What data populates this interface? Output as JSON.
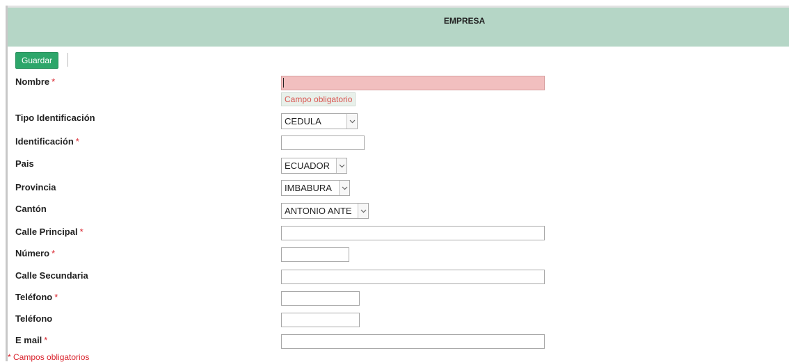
{
  "header": {
    "title": "EMPRESA"
  },
  "toolbar": {
    "save_label": "Guardar"
  },
  "required_mark": "*",
  "form": {
    "nombre": {
      "label": "Nombre",
      "value": "",
      "error": "Campo obligatorio"
    },
    "tipo_identificacion": {
      "label": "Tipo Identificación",
      "value": "CEDULA"
    },
    "identificacion": {
      "label": "Identificación",
      "value": ""
    },
    "pais": {
      "label": "Pais",
      "value": "ECUADOR"
    },
    "provincia": {
      "label": "Provincia",
      "value": "IMBABURA"
    },
    "canton": {
      "label": "Cantón",
      "value": "ANTONIO ANTE"
    },
    "calle_principal": {
      "label": "Calle Principal",
      "value": ""
    },
    "numero": {
      "label": "Número",
      "value": ""
    },
    "calle_secundaria": {
      "label": "Calle Secundaria",
      "value": ""
    },
    "telefono_1": {
      "label": "Teléfono",
      "value": ""
    },
    "telefono_2": {
      "label": "Teléfono",
      "value": ""
    },
    "email": {
      "label": "E mail",
      "value": ""
    }
  },
  "footer": {
    "note": "* Campos obligatorios"
  },
  "colors": {
    "header_bg": "#b5d6c6",
    "save_button": "#2da66a",
    "error_field": "#f2bfbf",
    "required": "#d9232d"
  }
}
